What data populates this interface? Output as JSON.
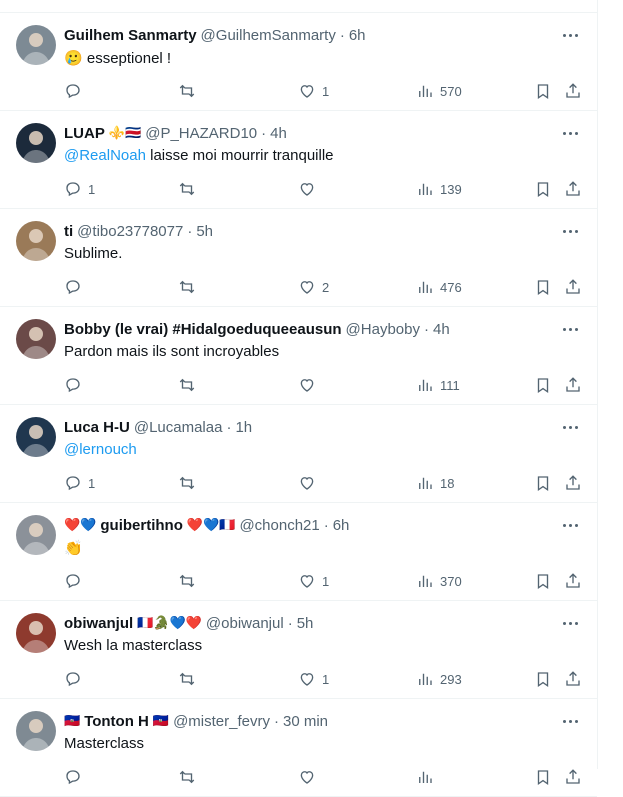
{
  "tweets": [
    {
      "display_name": "Guilhem Sanmarty",
      "prefix": "",
      "suffix": "",
      "handle": "@GuilhemSanmarty",
      "time": "6h",
      "text_emoji": "🥲",
      "text": "esseptionel !",
      "mention": "",
      "replies": "",
      "likes": "1",
      "views": "570",
      "avatar_color": "#7d8a94"
    },
    {
      "display_name": "LUAP",
      "prefix": "",
      "suffix": "⚜️🇨🇷",
      "handle": "@P_HAZARD10",
      "time": "4h",
      "text_emoji": "",
      "text": "laisse moi mourrir tranquille",
      "mention": "@RealNoah",
      "replies": "1",
      "likes": "",
      "views": "139",
      "avatar_color": "#1c2a3b"
    },
    {
      "display_name": "ti",
      "prefix": "",
      "suffix": "",
      "handle": "@tibo23778077",
      "time": "5h",
      "text_emoji": "",
      "text": "Sublime.",
      "mention": "",
      "replies": "",
      "likes": "2",
      "views": "476",
      "avatar_color": "#9a7a58"
    },
    {
      "display_name": "Bobby (le vrai) #Hidalgoeduqueeausun",
      "prefix": "",
      "suffix": "",
      "handle": "@Hayboby",
      "time": "4h",
      "text_emoji": "",
      "text": "Pardon mais ils sont incroyables",
      "mention": "",
      "replies": "",
      "likes": "",
      "views": "111",
      "avatar_color": "#6b4a48"
    },
    {
      "display_name": "Luca H-U",
      "prefix": "",
      "suffix": "",
      "handle": "@Lucamalaa",
      "time": "1h",
      "text_emoji": "",
      "text": "",
      "mention": "@lernouch",
      "replies": "1",
      "likes": "",
      "views": "18",
      "avatar_color": "#20374f"
    },
    {
      "display_name": "guibertihno",
      "prefix": "❤️💙",
      "suffix": "❤️💙🇫🇷",
      "handle": "@chonch21",
      "time": "6h",
      "text_emoji": "👏",
      "text": "",
      "mention": "",
      "replies": "",
      "likes": "1",
      "views": "370",
      "avatar_color": "#8b9199"
    },
    {
      "display_name": "obiwanjul",
      "prefix": "",
      "suffix": "🇫🇷🐊💙❤️",
      "handle": "@obiwanjul",
      "time": "5h",
      "text_emoji": "",
      "text": "Wesh la masterclass",
      "mention": "",
      "replies": "",
      "likes": "1",
      "views": "293",
      "avatar_color": "#8e3a2e"
    },
    {
      "display_name": "Tonton H",
      "prefix": "🇭🇹",
      "suffix": "🇭🇹",
      "handle": "@mister_fevry",
      "time": "30 min",
      "text_emoji": "",
      "text": "Masterclass",
      "mention": "",
      "replies": "",
      "likes": "",
      "views": "",
      "avatar_color": "#7f8a93"
    }
  ],
  "icons": {
    "reply": "reply-icon",
    "retweet": "retweet-icon",
    "like": "heart-icon",
    "views": "views-icon",
    "bookmark": "bookmark-icon",
    "share": "share-icon",
    "more": "more-icon"
  },
  "separator": "·"
}
